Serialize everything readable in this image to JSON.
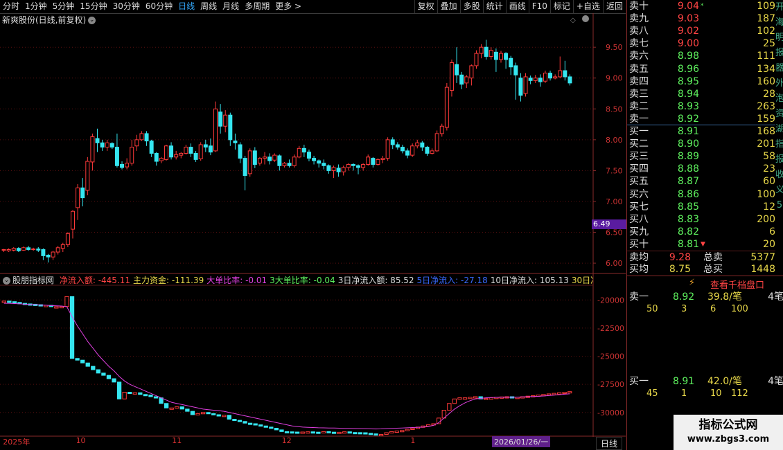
{
  "toolbar": {
    "periods": [
      "分时",
      "1分钟",
      "5分钟",
      "15分钟",
      "30分钟",
      "60分钟",
      "日线",
      "周线",
      "月线",
      "多周期",
      "更多 >"
    ],
    "active": "日线",
    "tools": [
      "复权",
      "叠加",
      "多股",
      "统计",
      "画线",
      "F10",
      "标记",
      "+自选",
      "返回"
    ]
  },
  "chart_title": "新爽股份(日线,前复权)",
  "price_cursor": "6.49",
  "indicator": {
    "name": "股朋指标网",
    "items": [
      {
        "label": "净流入额: -445.11",
        "color": "#ff4444"
      },
      {
        "label": "主力资金: -111.39",
        "color": "#e8d84a"
      },
      {
        "label": "大单比率: -0.01",
        "color": "#e040e0"
      },
      {
        "label": "3大单比率: -0.04",
        "color": "#5ef05e"
      },
      {
        "label": "3日净流入额: 85.52",
        "color": "#dddddd"
      },
      {
        "label": "5日净流入: -27.18",
        "color": "#3a6aff"
      },
      {
        "label": "10日净流入: 105.13",
        "color": "#dddddd"
      },
      {
        "label": "30日净",
        "color": "#e8d84a"
      }
    ]
  },
  "dates": [
    {
      "label": "2025年",
      "pos": 0.005
    },
    {
      "label": "10",
      "pos": 0.128
    },
    {
      "label": "11",
      "pos": 0.29
    },
    {
      "label": "12",
      "pos": 0.475
    },
    {
      "label": "1",
      "pos": 0.692
    }
  ],
  "cursor_date": "2026/01/26/一",
  "axis_period": "日线",
  "orderbook": {
    "asks": [
      {
        "label": "卖十",
        "price": "9.04",
        "vol": "109",
        "flag": "*",
        "pcolor": "red"
      },
      {
        "label": "卖九",
        "price": "9.03",
        "vol": "187",
        "pcolor": "red"
      },
      {
        "label": "卖八",
        "price": "9.02",
        "vol": "102",
        "pcolor": "red"
      },
      {
        "label": "卖七",
        "price": "9.00",
        "vol": "25",
        "pcolor": "red"
      },
      {
        "label": "卖六",
        "price": "8.98",
        "vol": "111",
        "pcolor": "green"
      },
      {
        "label": "卖五",
        "price": "8.96",
        "vol": "134",
        "pcolor": "green"
      },
      {
        "label": "卖四",
        "price": "8.95",
        "vol": "160",
        "pcolor": "green"
      },
      {
        "label": "卖三",
        "price": "8.94",
        "vol": "28",
        "pcolor": "green"
      },
      {
        "label": "卖二",
        "price": "8.93",
        "vol": "263",
        "pcolor": "green"
      },
      {
        "label": "卖一",
        "price": "8.92",
        "vol": "159",
        "pcolor": "green"
      }
    ],
    "bids": [
      {
        "label": "买一",
        "price": "8.91",
        "vol": "168",
        "pcolor": "green"
      },
      {
        "label": "买二",
        "price": "8.90",
        "vol": "201",
        "pcolor": "green"
      },
      {
        "label": "买三",
        "price": "8.89",
        "vol": "58",
        "pcolor": "green"
      },
      {
        "label": "买四",
        "price": "8.88",
        "vol": "23",
        "pcolor": "green"
      },
      {
        "label": "买五",
        "price": "8.87",
        "vol": "60",
        "pcolor": "green"
      },
      {
        "label": "买六",
        "price": "8.86",
        "vol": "100",
        "pcolor": "green"
      },
      {
        "label": "买七",
        "price": "8.85",
        "vol": "12",
        "pcolor": "green"
      },
      {
        "label": "买八",
        "price": "8.83",
        "vol": "200",
        "pcolor": "green"
      },
      {
        "label": "买九",
        "price": "8.82",
        "vol": "6",
        "pcolor": "green"
      },
      {
        "label": "买十",
        "price": "8.81",
        "vol": "20",
        "flag": "▼",
        "pcolor": "green"
      }
    ],
    "avg_ask": {
      "label": "卖均",
      "price": "9.28",
      "tlabel": "总卖",
      "total": "5377"
    },
    "avg_bid": {
      "label": "买均",
      "price": "8.75",
      "tlabel": "总买",
      "total": "1448"
    }
  },
  "side_strip_text": [
    "开",
    "海",
    "明",
    "报",
    "器",
    "外",
    "泡",
    "资",
    "湖",
    "指",
    "报",
    "收",
    "义",
    "5"
  ],
  "full_book_button": "查看千档盘口",
  "sell_one": {
    "label": "卖一",
    "price": "8.92",
    "lot": "39.8/笔",
    "count": "4笔",
    "queue": [
      "50",
      "3",
      "6",
      "100"
    ]
  },
  "buy_one": {
    "label": "买一",
    "price": "8.91",
    "lot": "42.0/笔",
    "count": "4笔",
    "queue": [
      "45",
      "1",
      "10",
      "112"
    ]
  },
  "watermark": {
    "line1": "指标公式网",
    "line2": "www.zbgs3.com"
  },
  "chart_data": [
    {
      "type": "candlestick",
      "title": "新爽股份(日线,前复权)",
      "ylim": [
        5.9,
        9.85
      ],
      "yticks": [
        "9.50",
        "9.00",
        "8.50",
        "8.00",
        "7.50",
        "7.00",
        "6.50",
        "6.00"
      ],
      "candles": [
        [
          6.21,
          6.22,
          6.23,
          6.18
        ],
        [
          6.2,
          6.22,
          6.24,
          6.18
        ],
        [
          6.21,
          6.24,
          6.26,
          6.19
        ],
        [
          6.24,
          6.2,
          6.26,
          6.18
        ],
        [
          6.21,
          6.25,
          6.27,
          6.2
        ],
        [
          6.25,
          6.22,
          6.28,
          6.2
        ],
        [
          6.22,
          6.23,
          6.25,
          6.2
        ],
        [
          6.23,
          6.21,
          6.26,
          6.18
        ],
        [
          6.22,
          6.12,
          6.24,
          6.05
        ],
        [
          6.13,
          6.1,
          6.15,
          6.01
        ],
        [
          6.1,
          6.18,
          6.2,
          6.05
        ],
        [
          6.18,
          6.25,
          6.28,
          6.14
        ],
        [
          6.24,
          6.3,
          6.33,
          6.18
        ],
        [
          6.3,
          6.48,
          6.5,
          6.26
        ],
        [
          6.55,
          6.84,
          6.86,
          6.4
        ],
        [
          6.9,
          7.22,
          7.28,
          6.7
        ],
        [
          7.22,
          7.06,
          7.38,
          6.92
        ],
        [
          7.18,
          7.65,
          7.72,
          7.1
        ],
        [
          7.64,
          8.05,
          8.1,
          7.5
        ],
        [
          8.02,
          7.95,
          8.18,
          7.8
        ],
        [
          7.95,
          7.88,
          8.0,
          7.82
        ],
        [
          7.88,
          7.95,
          8.0,
          7.82
        ],
        [
          7.94,
          7.88,
          7.96,
          7.85
        ],
        [
          7.88,
          7.58,
          8.1,
          7.55
        ],
        [
          7.6,
          7.55,
          7.65,
          7.52
        ],
        [
          7.56,
          7.62,
          7.7,
          7.52
        ],
        [
          7.62,
          7.88,
          8.0,
          7.58
        ],
        [
          7.9,
          8.0,
          8.08,
          7.82
        ],
        [
          8.0,
          8.1,
          8.14,
          7.98
        ],
        [
          8.1,
          7.98,
          8.14,
          7.9
        ],
        [
          7.98,
          7.78,
          8.0,
          7.72
        ],
        [
          7.78,
          7.65,
          7.8,
          7.58
        ],
        [
          7.66,
          7.7,
          7.72,
          7.62
        ],
        [
          7.68,
          7.9,
          7.92,
          7.66
        ],
        [
          7.9,
          7.72,
          7.96,
          7.68
        ],
        [
          7.72,
          7.76,
          7.82,
          7.68
        ],
        [
          7.75,
          7.78,
          7.8,
          7.7
        ],
        [
          7.78,
          7.88,
          7.92,
          7.76
        ],
        [
          7.88,
          7.78,
          7.94,
          7.72
        ],
        [
          7.78,
          7.68,
          7.82,
          7.64
        ],
        [
          7.69,
          7.92,
          7.96,
          7.66
        ],
        [
          7.92,
          7.88,
          8.0,
          7.8
        ],
        [
          7.9,
          7.8,
          8.02,
          7.75
        ],
        [
          7.82,
          8.5,
          8.62,
          7.8
        ],
        [
          8.45,
          8.22,
          8.58,
          8.1
        ],
        [
          8.22,
          8.4,
          8.48,
          8.12
        ],
        [
          8.4,
          8.0,
          8.44,
          7.9
        ],
        [
          7.98,
          7.95,
          8.1,
          7.84
        ],
        [
          7.92,
          7.7,
          7.96,
          7.62
        ],
        [
          7.7,
          7.42,
          7.74,
          7.18
        ],
        [
          7.45,
          7.82,
          7.86,
          7.4
        ],
        [
          7.82,
          7.6,
          7.88,
          7.54
        ],
        [
          7.62,
          7.7,
          7.72,
          7.58
        ],
        [
          7.7,
          7.72,
          7.8,
          7.6
        ],
        [
          7.72,
          7.66,
          7.78,
          7.6
        ],
        [
          7.67,
          7.75,
          7.78,
          7.64
        ],
        [
          7.74,
          7.58,
          7.76,
          7.5
        ],
        [
          7.58,
          7.62,
          7.64,
          7.55
        ],
        [
          7.62,
          7.58,
          7.68,
          7.55
        ],
        [
          7.58,
          7.72,
          7.76,
          7.55
        ],
        [
          7.72,
          7.86,
          7.9,
          7.7
        ],
        [
          7.86,
          7.8,
          7.92,
          7.72
        ],
        [
          7.8,
          7.7,
          7.84,
          7.65
        ],
        [
          7.7,
          7.66,
          7.74,
          7.6
        ],
        [
          7.66,
          7.62,
          7.68,
          7.55
        ],
        [
          7.62,
          7.58,
          7.68,
          7.52
        ],
        [
          7.58,
          7.5,
          7.6,
          7.45
        ],
        [
          7.5,
          7.55,
          7.58,
          7.38
        ],
        [
          7.54,
          7.48,
          7.6,
          7.4
        ],
        [
          7.48,
          7.55,
          7.58,
          7.42
        ],
        [
          7.55,
          7.6,
          7.62,
          7.5
        ],
        [
          7.6,
          7.58,
          7.62,
          7.5
        ],
        [
          7.58,
          7.55,
          7.6,
          7.44
        ],
        [
          7.55,
          7.6,
          7.62,
          7.5
        ],
        [
          7.6,
          7.72,
          7.76,
          7.58
        ],
        [
          7.7,
          7.6,
          7.72,
          7.55
        ],
        [
          7.6,
          7.68,
          7.7,
          7.58
        ],
        [
          7.68,
          7.7,
          7.74,
          7.62
        ],
        [
          7.7,
          8.0,
          8.04,
          7.66
        ],
        [
          8.0,
          7.92,
          8.04,
          7.85
        ],
        [
          7.92,
          7.88,
          7.96,
          7.84
        ],
        [
          7.88,
          7.82,
          7.92,
          7.78
        ],
        [
          7.82,
          7.75,
          7.86,
          7.7
        ],
        [
          7.75,
          7.9,
          7.94,
          7.72
        ],
        [
          7.9,
          7.95,
          8.0,
          7.86
        ],
        [
          7.95,
          7.88,
          7.98,
          7.82
        ],
        [
          7.88,
          7.78,
          7.9,
          7.74
        ],
        [
          7.78,
          7.82,
          7.86,
          7.76
        ],
        [
          7.82,
          8.1,
          8.15,
          7.8
        ],
        [
          8.1,
          8.22,
          8.26,
          8.05
        ],
        [
          8.2,
          8.85,
          8.92,
          8.15
        ],
        [
          8.8,
          9.25,
          9.3,
          8.7
        ],
        [
          9.22,
          9.05,
          9.5,
          8.92
        ],
        [
          9.05,
          8.9,
          9.1,
          8.82
        ],
        [
          8.92,
          9.02,
          9.05,
          8.84
        ],
        [
          9.0,
          9.2,
          9.22,
          8.88
        ],
        [
          9.2,
          9.4,
          9.45,
          9.15
        ],
        [
          9.4,
          9.5,
          9.55,
          9.32
        ],
        [
          9.5,
          9.35,
          9.62,
          9.3
        ],
        [
          9.35,
          9.45,
          9.5,
          9.3
        ],
        [
          9.42,
          9.3,
          9.48,
          9.1
        ],
        [
          9.3,
          9.4,
          9.44,
          9.25
        ],
        [
          9.4,
          9.3,
          9.42,
          9.15
        ],
        [
          9.32,
          9.18,
          9.36,
          9.05
        ],
        [
          9.2,
          9.05,
          9.25,
          8.65
        ],
        [
          9.0,
          8.72,
          9.08,
          8.62
        ],
        [
          8.75,
          9.02,
          9.08,
          8.7
        ],
        [
          9.0,
          8.96,
          9.04,
          8.9
        ],
        [
          8.96,
          9.0,
          9.05,
          8.92
        ],
        [
          9.0,
          8.94,
          9.06,
          8.86
        ],
        [
          8.95,
          9.08,
          9.12,
          8.92
        ],
        [
          9.08,
          9.0,
          9.12,
          8.96
        ],
        [
          9.0,
          9.02,
          9.06,
          8.98
        ],
        [
          9.02,
          9.12,
          9.35,
          9.0
        ],
        [
          9.12,
          9.02,
          9.28,
          8.96
        ],
        [
          9.02,
          8.92,
          9.06,
          8.88
        ]
      ]
    },
    {
      "type": "bar",
      "title": "股朋指标网",
      "ylim": [
        -31800,
        -19000
      ],
      "yticks": [
        "-20000",
        "-22500",
        "-25000",
        "-27500",
        "-30000"
      ],
      "values": [
        -20100,
        -20150,
        -20220,
        -20300,
        -20350,
        -20380,
        -20420,
        -20500,
        -20480,
        -20600,
        -20600,
        -20580,
        -19700,
        -25200,
        -25350,
        -25600,
        -25900,
        -26200,
        -26500,
        -26700,
        -27000,
        -27300,
        -28800,
        -28200,
        -28300,
        -28250,
        -28400,
        -28450,
        -28600,
        -28700,
        -29200,
        -29600,
        -29600,
        -29500,
        -29700,
        -29900,
        -30200,
        -30100,
        -30000,
        -30100,
        -30200,
        -30300,
        -30250,
        -30600,
        -30700,
        -30800,
        -30950,
        -31000,
        -31100,
        -31200,
        -31300,
        -31400,
        -31550,
        -31700,
        -31720,
        -31740,
        -31750,
        -31740,
        -31720,
        -31750,
        -31800,
        -31700,
        -31750,
        -31780,
        -31760,
        -31720,
        -31780,
        -31790,
        -31800,
        -31850,
        -31900,
        -32000,
        -31950,
        -31800,
        -31700,
        -31650,
        -31600,
        -31500,
        -31400,
        -31300,
        -31200,
        -31100,
        -31000,
        -30500,
        -29800,
        -29200,
        -28800,
        -28700,
        -28700,
        -28650,
        -28600,
        -28800,
        -28750,
        -28700,
        -28650,
        -28620,
        -28600,
        -28700,
        -28650,
        -28600,
        -28550,
        -28500,
        -28450,
        -28400,
        -28350,
        -28300,
        -28250,
        -28200,
        -28150
      ],
      "ma_line": [
        -20300,
        -20300,
        -20320,
        -20350,
        -20380,
        -20400,
        -20420,
        -20450,
        -20470,
        -20500,
        -20520,
        -20540,
        -20600,
        -21500,
        -22300,
        -23000,
        -23700,
        -24300,
        -24900,
        -25400,
        -25900,
        -26300,
        -26800,
        -27200,
        -27500,
        -27700,
        -27900,
        -28100,
        -28300,
        -28500,
        -28700,
        -28900,
        -29100,
        -29200,
        -29300,
        -29400,
        -29500,
        -29600,
        -29700,
        -29750,
        -29800,
        -29850,
        -29900,
        -30000,
        -30100,
        -30200,
        -30300,
        -30400,
        -30500,
        -30600,
        -30700,
        -30800,
        -30900,
        -31000,
        -31100,
        -31200,
        -31250,
        -31300,
        -31320,
        -31340,
        -31360,
        -31370,
        -31380,
        -31390,
        -31400,
        -31410,
        -31420,
        -31430,
        -31440,
        -31450,
        -31460,
        -31470,
        -31460,
        -31440,
        -31420,
        -31400,
        -31380,
        -31360,
        -31340,
        -31320,
        -31300,
        -31250,
        -31150,
        -30900,
        -30500,
        -30100,
        -29700,
        -29400,
        -29150,
        -28950,
        -28800,
        -28750,
        -28700,
        -28680,
        -28660,
        -28650,
        -28640,
        -28650,
        -28640,
        -28620,
        -28600,
        -28580,
        -28560,
        -28540,
        -28500,
        -28460,
        -28420,
        -28380,
        -28350
      ]
    }
  ]
}
